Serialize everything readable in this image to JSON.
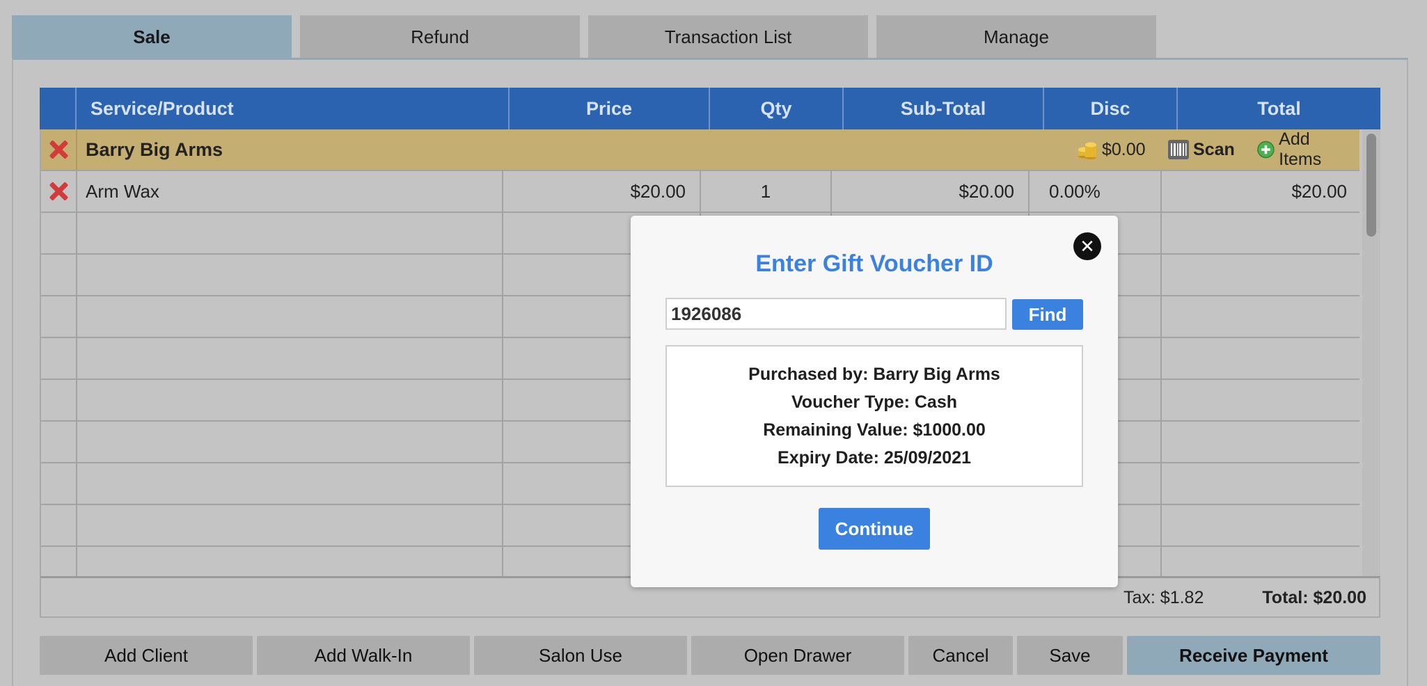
{
  "tabs": [
    {
      "label": "Sale",
      "active": true
    },
    {
      "label": "Refund",
      "active": false
    },
    {
      "label": "Transaction List",
      "active": false
    },
    {
      "label": "Manage",
      "active": false
    }
  ],
  "table": {
    "headers": [
      "Service/Product",
      "Price",
      "Qty",
      "Sub-Total",
      "Disc",
      "Total"
    ],
    "client_row": {
      "name": "Barry Big Arms",
      "balance": "$0.00",
      "scan_label": "Scan",
      "add_items_label": "Add Items"
    },
    "items": [
      {
        "name": "Arm Wax",
        "price": "$20.00",
        "qty": "1",
        "subtotal": "$20.00",
        "disc": "0.00%",
        "total": "$20.00"
      }
    ],
    "footer": {
      "tax": "Tax: $1.82",
      "total": "Total: $20.00"
    }
  },
  "buttons": {
    "add_client": "Add Client",
    "add_walkin": "Add Walk-In",
    "salon_use": "Salon Use",
    "open_drawer": "Open Drawer",
    "cancel": "Cancel",
    "save": "Save",
    "receive_payment": "Receive Payment"
  },
  "modal": {
    "title": "Enter Gift Voucher ID",
    "close_symbol": "✕",
    "voucher_id": "1926086",
    "find_label": "Find",
    "info": {
      "purchased_by": "Purchased by: Barry Big Arms",
      "voucher_type": "Voucher Type: Cash",
      "remaining_value": "Remaining Value: $1000.00",
      "expiry_date": "Expiry Date: 25/09/2021"
    },
    "continue_label": "Continue"
  },
  "colors": {
    "header_blue": "#2b63b0",
    "accent_blue": "#3b82e0",
    "client_row": "#c5ae72",
    "active_tab": "#8fa9b9"
  },
  "icons": [
    "remove-icon",
    "coins-icon",
    "barcode-icon",
    "add-circle-icon",
    "close-icon"
  ]
}
